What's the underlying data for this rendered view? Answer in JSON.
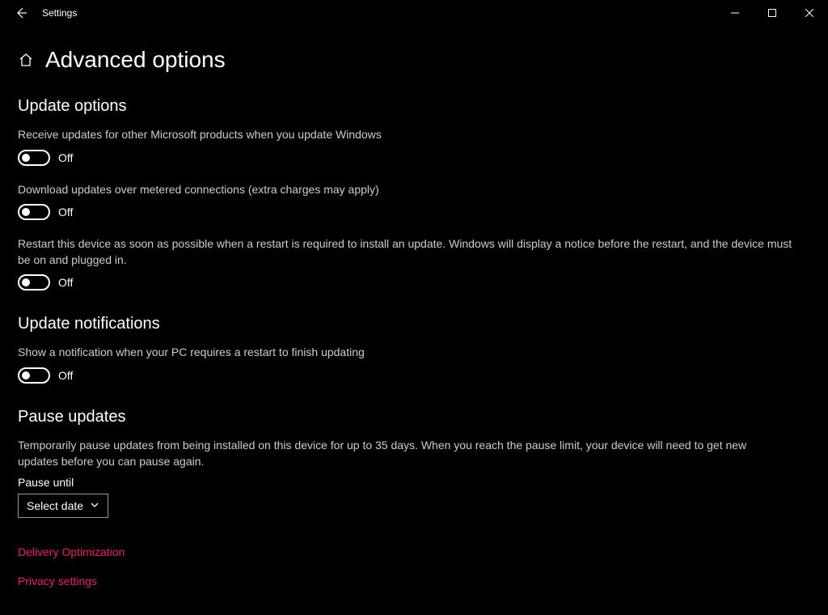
{
  "window": {
    "title": "Settings"
  },
  "page": {
    "title": "Advanced options"
  },
  "sections": {
    "update_options": {
      "title": "Update options",
      "settings": {
        "other_products": {
          "label": "Receive updates for other Microsoft products when you update Windows",
          "state": "Off"
        },
        "metered": {
          "label": "Download updates over metered connections (extra charges may apply)",
          "state": "Off"
        },
        "restart": {
          "label": "Restart this device as soon as possible when a restart is required to install an update. Windows will display a notice before the restart, and the device must be on and plugged in.",
          "state": "Off"
        }
      }
    },
    "notifications": {
      "title": "Update notifications",
      "settings": {
        "restart_notify": {
          "label": "Show a notification when your PC requires a restart to finish updating",
          "state": "Off"
        }
      }
    },
    "pause": {
      "title": "Pause updates",
      "description": "Temporarily pause updates from being installed on this device for up to 35 days. When you reach the pause limit, your device will need to get new updates before you can pause again.",
      "until_label": "Pause until",
      "combo_value": "Select date"
    }
  },
  "links": {
    "delivery": "Delivery Optimization",
    "privacy": "Privacy settings"
  }
}
